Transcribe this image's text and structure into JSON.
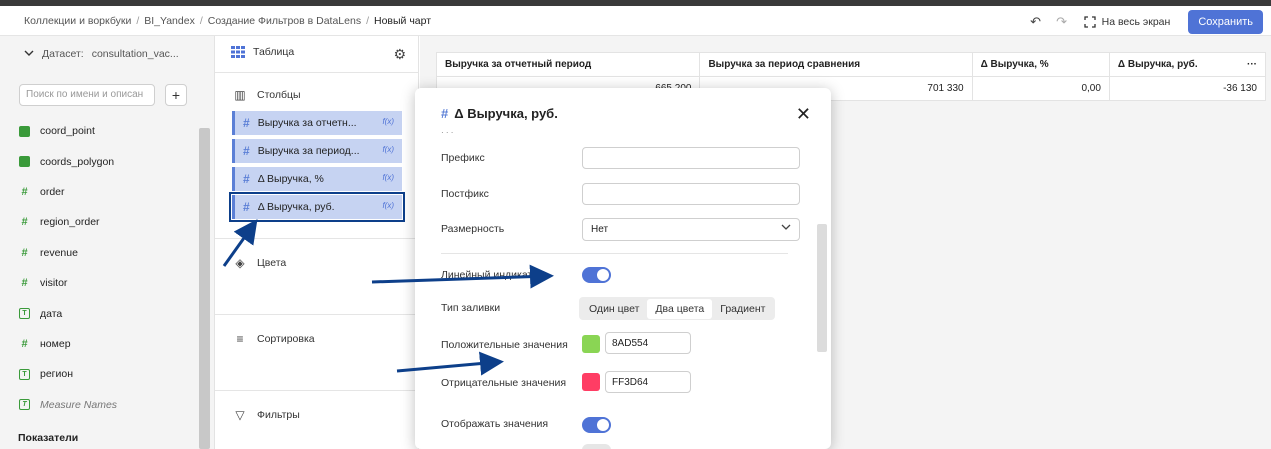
{
  "breadcrumbs": [
    "Коллекции и воркбуки",
    "BI_Yandex",
    "Создание Фильтров в DataLens",
    "Новый чарт"
  ],
  "toolbar": {
    "fullscreen_label": "На весь экран",
    "save_label": "Сохранить",
    "undo_icon": "undo-icon",
    "redo_icon": "redo-icon"
  },
  "dataset": {
    "label": "Датасет:",
    "name": "consultation_vac...",
    "search_placeholder": "Поиск по имени и описан",
    "fields": [
      {
        "name": "coord_point",
        "icon": "geo-point-icon",
        "measure": false
      },
      {
        "name": "coords_polygon",
        "icon": "geo-polygon-icon",
        "measure": false
      },
      {
        "name": "order",
        "icon": "number-icon",
        "measure": false
      },
      {
        "name": "region_order",
        "icon": "number-icon",
        "measure": false
      },
      {
        "name": "revenue",
        "icon": "number-icon",
        "measure": false
      },
      {
        "name": "visitor",
        "icon": "number-icon",
        "measure": false
      },
      {
        "name": "дата",
        "icon": "text-icon",
        "measure": false
      },
      {
        "name": "номер",
        "icon": "number-icon",
        "measure": false
      },
      {
        "name": "регион",
        "icon": "text-icon",
        "measure": false
      },
      {
        "name": "Measure Names",
        "icon": "text-icon",
        "measure": true
      }
    ],
    "section_label": "Показатели"
  },
  "wizard": {
    "visualization": "Таблица",
    "columns_label": "Столбцы",
    "columns": [
      "Выручка за отчетн...",
      "Выручка за период...",
      "Δ Выручка, %",
      "Δ Выручка, руб."
    ],
    "fx_label": "f(x)",
    "colors_label": "Цвета",
    "sort_label": "Сортировка",
    "filters_label": "Фильтры"
  },
  "table": {
    "headers": [
      "Выручка за отчетный период",
      "Выручка за период сравнения",
      "Δ Выручка, %",
      "Δ Выручка, руб."
    ],
    "rows": [
      [
        "665 200",
        "701 330",
        "0,00",
        "-36 130"
      ]
    ],
    "more_label": "···"
  },
  "modal": {
    "title_icon": "#",
    "title": "Δ Выручка, руб.",
    "prefix_label": "Префикс",
    "prefix_value": "",
    "postfix_label": "Постфикс",
    "postfix_value": "",
    "unit_label": "Размерность",
    "unit_value": "Нет",
    "bar_label": "Линейный индикатор",
    "bar_enabled": true,
    "fill_label": "Тип заливки",
    "fill_options": [
      "Один цвет",
      "Два цвета",
      "Градиент"
    ],
    "fill_selected": "Два цвета",
    "positive_label": "Положительные значения",
    "positive_color": "8AD554",
    "negative_label": "Отрицательные значения",
    "negative_color": "FF3D64",
    "show_values_label": "Отображать значения",
    "show_values_enabled": true
  },
  "colors": {
    "accent": "#4f73d6",
    "positive": "#8AD554",
    "negative": "#FF3D64",
    "annotation": "#0d3f8a"
  }
}
